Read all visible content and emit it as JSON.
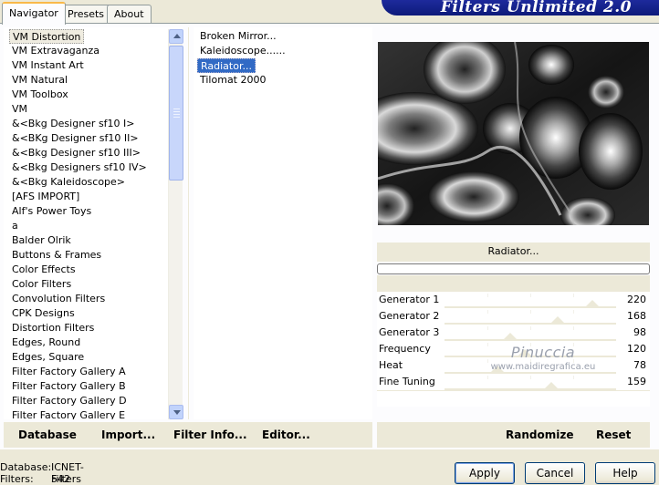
{
  "tabs": [
    "Navigator",
    "Presets",
    "About"
  ],
  "banner": {
    "title": "Filters Unlimited 2.0"
  },
  "filter_categories": {
    "selected_index": 0,
    "items": [
      "VM Distortion",
      "VM Extravaganza",
      "VM Instant Art",
      "VM Natural",
      "VM Toolbox",
      "VM",
      "&<Bkg Designer sf10 I>",
      "&<BKg Designer sf10 II>",
      "&<Bkg Designer sf10 III>",
      "&<Bkg Designers sf10 IV>",
      "&<Bkg Kaleidoscope>",
      "[AFS IMPORT]",
      "Alf's Power Toys",
      "a",
      "Balder Olrik",
      "Buttons & Frames",
      "Color Effects",
      "Color Filters",
      "Convolution Filters",
      "CPK Designs",
      "Distortion Filters",
      "Edges, Round",
      "Edges, Square",
      "Filter Factory Gallery A",
      "Filter Factory Gallery B",
      "Filter Factory Gallery D",
      "Filter Factory Gallery E"
    ]
  },
  "filter_effects": {
    "selected_index": 2,
    "items": [
      "Broken Mirror...",
      "Kaleidoscope......",
      "Radiator...",
      "Tilomat 2000"
    ]
  },
  "preview": {
    "filter_name": "Radiator..."
  },
  "sliders": [
    {
      "label": "Generator 1",
      "value": 220
    },
    {
      "label": "Generator 2",
      "value": 168
    },
    {
      "label": "Generator 3",
      "value": 98
    },
    {
      "label": "Frequency",
      "value": 120
    },
    {
      "label": "Heat",
      "value": 78
    },
    {
      "label": "Fine Tuning",
      "value": 159
    }
  ],
  "slider_max": 255,
  "watermark": {
    "line1": "Pinuccia",
    "line2": "www.maidiregrafica.eu"
  },
  "left_toolbar": {
    "database": "Database",
    "import": "Import...",
    "filter_info": "Filter Info...",
    "editor": "Editor..."
  },
  "right_toolbar": {
    "randomize": "Randomize",
    "reset": "Reset"
  },
  "status": {
    "database_label": "Database:",
    "database_value": "ICNET-Filters",
    "filters_label": "Filters:",
    "filters_value": "542"
  },
  "buttons": {
    "apply": "Apply",
    "cancel": "Cancel",
    "help": "Help"
  },
  "colors": {
    "selection_blue": "#316ac5",
    "banner_blue": "#13208c",
    "panel_bg": "#ece9d8"
  }
}
